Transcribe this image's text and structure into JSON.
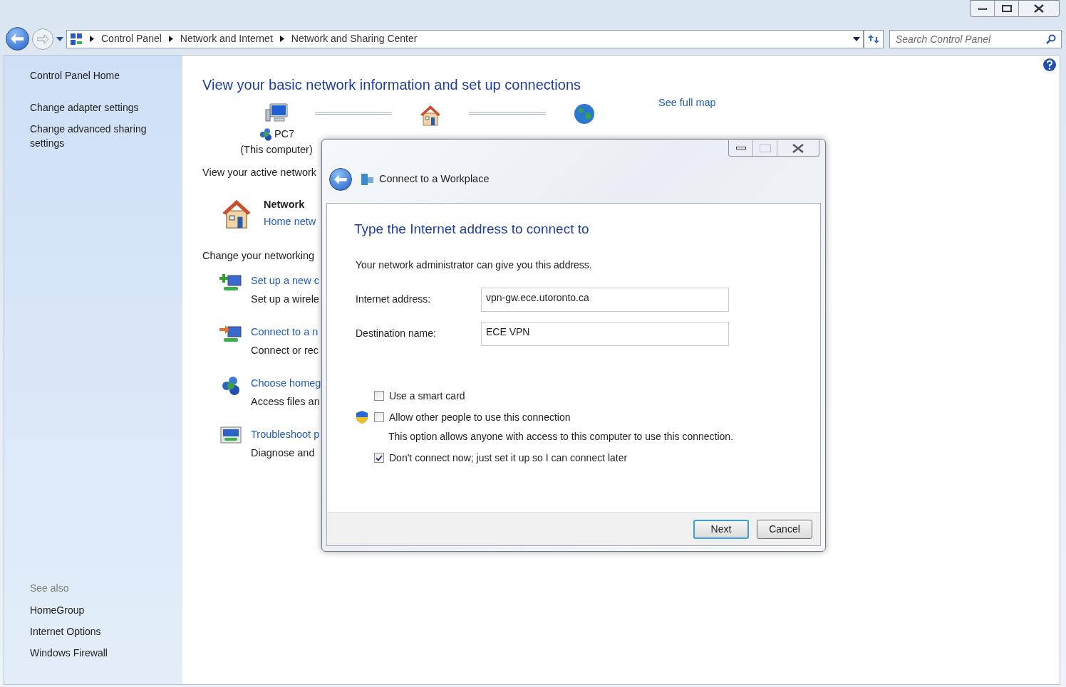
{
  "window": {
    "breadcrumb": [
      "Control Panel",
      "Network and Internet",
      "Network and Sharing Center"
    ],
    "search_placeholder": "Search Control Panel"
  },
  "sidebar": {
    "items": [
      "Control Panel Home",
      "Change adapter settings",
      "Change advanced sharing settings"
    ],
    "see_also_title": "See also",
    "see_also": [
      "HomeGroup",
      "Internet Options",
      "Windows Firewall"
    ]
  },
  "main": {
    "title": "View your basic network information and set up connections",
    "map": {
      "nodes": [
        {
          "kind": "computer",
          "label": "PC7",
          "sublabel": "(This computer)"
        },
        {
          "kind": "house"
        },
        {
          "kind": "globe"
        }
      ],
      "link": "See full map"
    },
    "active_heading": "View your active network",
    "network": {
      "name": "Network",
      "type": "Home netw"
    },
    "change_heading": "Change your networking",
    "tasks": [
      {
        "kind": "setup",
        "link": "Set up a new c",
        "description": "Set up a wirele"
      },
      {
        "kind": "connect",
        "link": "Connect to a n",
        "description": "Connect or rec"
      },
      {
        "kind": "homegroup",
        "link": "Choose homeg",
        "description": "Access files an"
      },
      {
        "kind": "troubleshoot",
        "link": "Troubleshoot p",
        "description": "Diagnose and"
      }
    ]
  },
  "dialog": {
    "title": "Connect to a Workplace",
    "heading": "Type the Internet address to connect to",
    "intro": "Your network administrator can give you this address.",
    "fields": [
      {
        "label": "Internet address:",
        "value": "vpn-gw.ece.utoronto.ca"
      },
      {
        "label": "Destination name:",
        "value": "ECE VPN"
      }
    ],
    "options": [
      {
        "label": "Use a smart card",
        "checked": false,
        "shield": false
      },
      {
        "label": "Allow other people to use this connection",
        "checked": false,
        "shield": true,
        "note": "This option allows anyone with access to this computer to use this connection."
      },
      {
        "label": "Don't connect now; just set it up so I can connect later",
        "checked": true,
        "shield": false
      }
    ],
    "buttons": [
      {
        "label": "Next",
        "default": true
      },
      {
        "label": "Cancel",
        "default": false
      }
    ]
  }
}
